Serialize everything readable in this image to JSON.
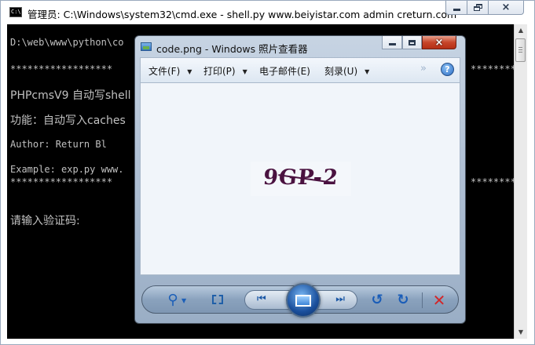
{
  "cmd": {
    "title": "管理员: C:\\Windows\\system32\\cmd.exe - shell.py  www.beiyistar.com admin creturn.com",
    "lines": [
      "D:\\web\\www\\python\\co",
      "******************",
      "PHPcmsV9 自动写shell",
      "功能：自动写入caches",
      "Author: Return     Bl",
      "Example: exp.py www.",
      "******************",
      "请输入验证码:"
    ],
    "stars_right_top": "**********",
    "stars_right_bottom": "**********",
    "icon_text": "C:\\"
  },
  "viewer": {
    "title": "code.png - Windows 照片查看器",
    "menu": {
      "file": "文件(F)",
      "print": "打印(P)",
      "email": "电子邮件(E)",
      "burn": "刻录(U)"
    },
    "more_glyph": "»",
    "help_glyph": "?",
    "captcha_text": "9GP-2"
  },
  "icons": {
    "close": "×",
    "zoom": "⚲",
    "prev": "⏮",
    "next": "⏭",
    "rotate_left": "↺",
    "rotate_right": "↻",
    "delete": "✕",
    "caret": "▼"
  }
}
